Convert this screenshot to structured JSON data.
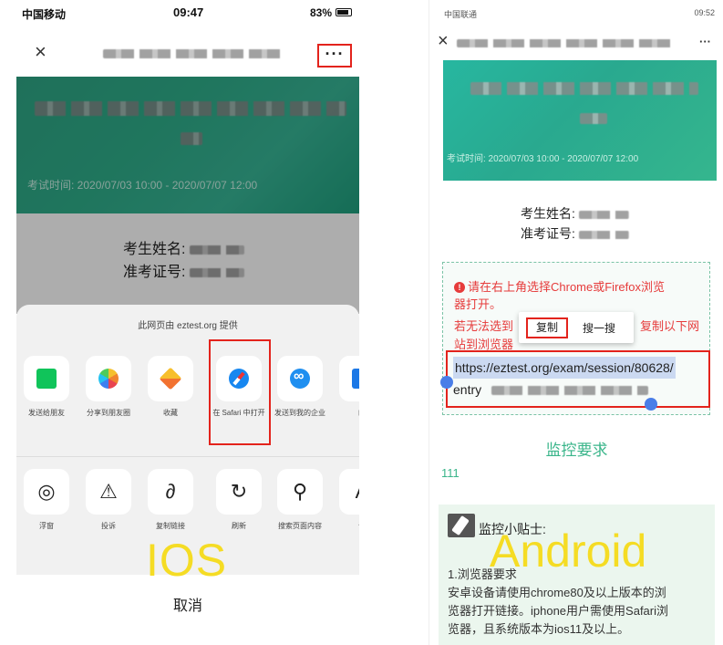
{
  "ios": {
    "status": {
      "carrier": "中国移动",
      "time": "09:47",
      "battery": "83%"
    },
    "nav": {
      "close_icon": "×",
      "more_label": "···"
    },
    "banner": {
      "exam_time": "考试时间: 2020/07/03 10:00 - 2020/07/07 12:00"
    },
    "info": {
      "name_label": "考生姓名:",
      "id_label": "准考证号:"
    },
    "sheet": {
      "source": "此网页由 eztest.org 提供",
      "apps": [
        {
          "label": "发送给朋友",
          "icon": "share-icon"
        },
        {
          "label": "分享到朋友圈",
          "icon": "moments-icon"
        },
        {
          "label": "收藏",
          "icon": "favorite-icon"
        },
        {
          "label": "在 Safari 中打开",
          "icon": "safari-icon"
        },
        {
          "label": "发送到我的企业",
          "icon": "wework-icon"
        },
        {
          "label": "邮",
          "icon": "mail-icon"
        }
      ],
      "actions": [
        {
          "label": "浮窗",
          "icon": "float-window-icon",
          "glyph": "◎"
        },
        {
          "label": "投诉",
          "icon": "complaint-icon",
          "glyph": "⚠"
        },
        {
          "label": "复制链接",
          "icon": "link-icon",
          "glyph": "∂"
        },
        {
          "label": "刷新",
          "icon": "refresh-icon",
          "glyph": "↻"
        },
        {
          "label": "搜索页面内容",
          "icon": "search-icon",
          "glyph": "⚲"
        },
        {
          "label": "调",
          "icon": "font-icon",
          "glyph": "A"
        }
      ],
      "cancel": "取消"
    },
    "platform_label": "IOS"
  },
  "android": {
    "status": {
      "carrier": "中国联通",
      "time": "09:52"
    },
    "nav": {
      "close_icon": "×",
      "more_label": "···"
    },
    "banner": {
      "exam_time": "考试时间: 2020/07/03 10:00 - 2020/07/07 12:00"
    },
    "info": {
      "name_label": "考生姓名:",
      "id_label": "准考证号:"
    },
    "tip": {
      "line1": "请在右上角选择Chrome或Firefox浏览",
      "line2": "器打开。",
      "line3_left": "若无法选到",
      "line3_right": "复制以下网",
      "line4": "站到浏览器"
    },
    "context_menu": {
      "copy": "复制",
      "search": "搜一搜"
    },
    "url": {
      "line1": "https://eztest.org/exam/session/80628/",
      "line2": "entry"
    },
    "monitor_title": "监控要求",
    "number": "111",
    "tips_box": {
      "heading": "监控小贴士:",
      "subheading": "1.浏览器要求",
      "lines": [
        "安卓设备请使用chrome80及以上版本的浏",
        "览器打开链接。iphone用户需使用Safari浏",
        "览器，且系统版本为ios11及以上。"
      ]
    },
    "platform_label": "Android"
  }
}
